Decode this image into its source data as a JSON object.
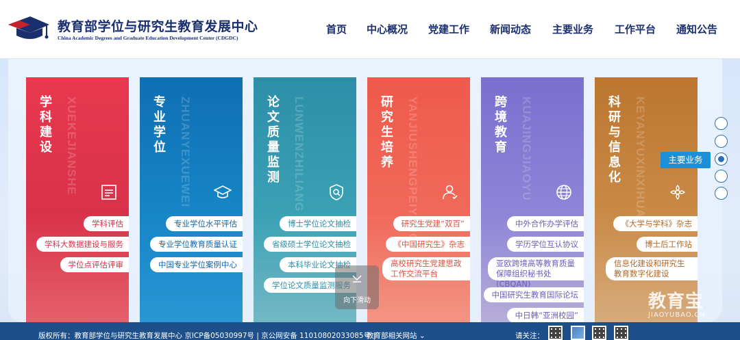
{
  "header": {
    "site_title_cn": "教育部学位与研究生教育发展中心",
    "site_title_en": "China Academic Degrees and Graduate Education Development Center (CDGDC)",
    "nav": [
      "首页",
      "中心概况",
      "党建工作",
      "新闻动态",
      "主要业务",
      "工作平台",
      "通知公告"
    ]
  },
  "cards": [
    {
      "title": "学科建设",
      "pinyin": "XUEKEJIANSHE",
      "icon": "document-icon",
      "links": [
        "学科评估",
        "学科大数据建设与服务",
        "学位点评估评审"
      ]
    },
    {
      "title": "专业学位",
      "pinyin": "ZHUANYEXUEWEI",
      "icon": "graduation-cap-icon",
      "links": [
        "专业学位水平评估",
        "专业学位教育质量认证",
        "中国专业学位案例中心"
      ]
    },
    {
      "title": "论文质量监测",
      "pinyin": "LUNWENZHILIANG",
      "icon": "shield-search-icon",
      "links": [
        "博士学位论文抽检",
        "省级硕士学位论文抽检",
        "本科毕业论文抽检",
        "学位论文质量监测服务"
      ]
    },
    {
      "title": "研究生培养",
      "pinyin": "YANJIUSHENGPEIYANG",
      "icon": "person-icon",
      "links": [
        "研究生党建“双百”",
        "《中国研究生》杂志",
        "高校研究生党建思政工作交流平台"
      ]
    },
    {
      "title": "跨境教育",
      "pinyin": "KUAJINGJIAOYU",
      "icon": "globe-icon",
      "links": [
        "中外合作办学评估",
        "学历学位互认协议",
        "亚欧跨境高等教育质量保障组织秘书处(CBQAN)",
        "中国研究生教育国际论坛",
        "中日韩“亚洲校园”"
      ]
    },
    {
      "title": "科研与信息化",
      "pinyin": "KEYANYUXINXIHUA",
      "icon": "flower-icon",
      "links": [
        "《大学与学科》杂志",
        "博士后工作站",
        "信息化建设和研究生教育数字化建设"
      ]
    }
  ],
  "pager": {
    "tip": "主要业务",
    "dots": 5,
    "active_index": 2
  },
  "scroll_hint": "向下滑动",
  "watermark": {
    "cn": "教育宝",
    "en": "JIAOYUBAO.CN"
  },
  "footer": {
    "copyright": "版权所有：教育部学位与研究生教育发展中心 京ICP备05030997号 | 京公网安备 11010802033085号 |",
    "related": "教育部相关网站 ⌄",
    "follow": "请关注："
  }
}
